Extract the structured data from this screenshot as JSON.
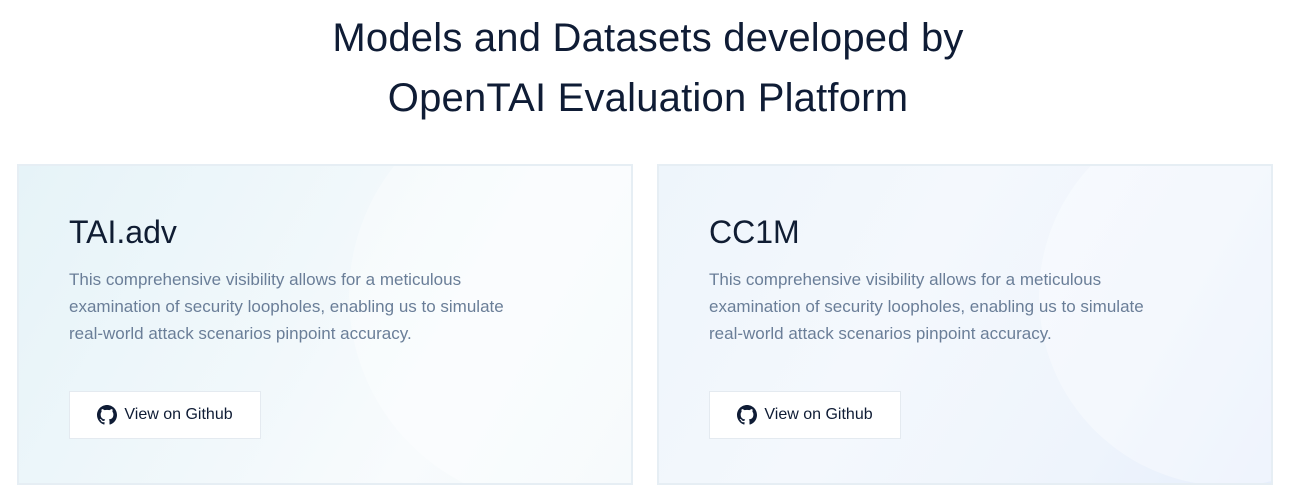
{
  "header": {
    "title_line1": "Models and Datasets developed by",
    "title_line2": "OpenTAI Evaluation Platform"
  },
  "cards": [
    {
      "title": "TAI.adv",
      "description": "This comprehensive visibility allows for a meticulous examination of security loopholes, enabling us to simulate real-world attack scenarios pinpoint accuracy.",
      "button_label": "View on Github",
      "button_icon": "github-icon"
    },
    {
      "title": "CC1M",
      "description": "This comprehensive visibility allows for a meticulous examination of security loopholes, enabling us to simulate real-world attack scenarios pinpoint accuracy.",
      "button_label": "View on Github",
      "button_icon": "github-icon"
    }
  ],
  "colors": {
    "title": "#0f1c35",
    "description": "#6a7e98",
    "card_border": "#e6eef4"
  }
}
